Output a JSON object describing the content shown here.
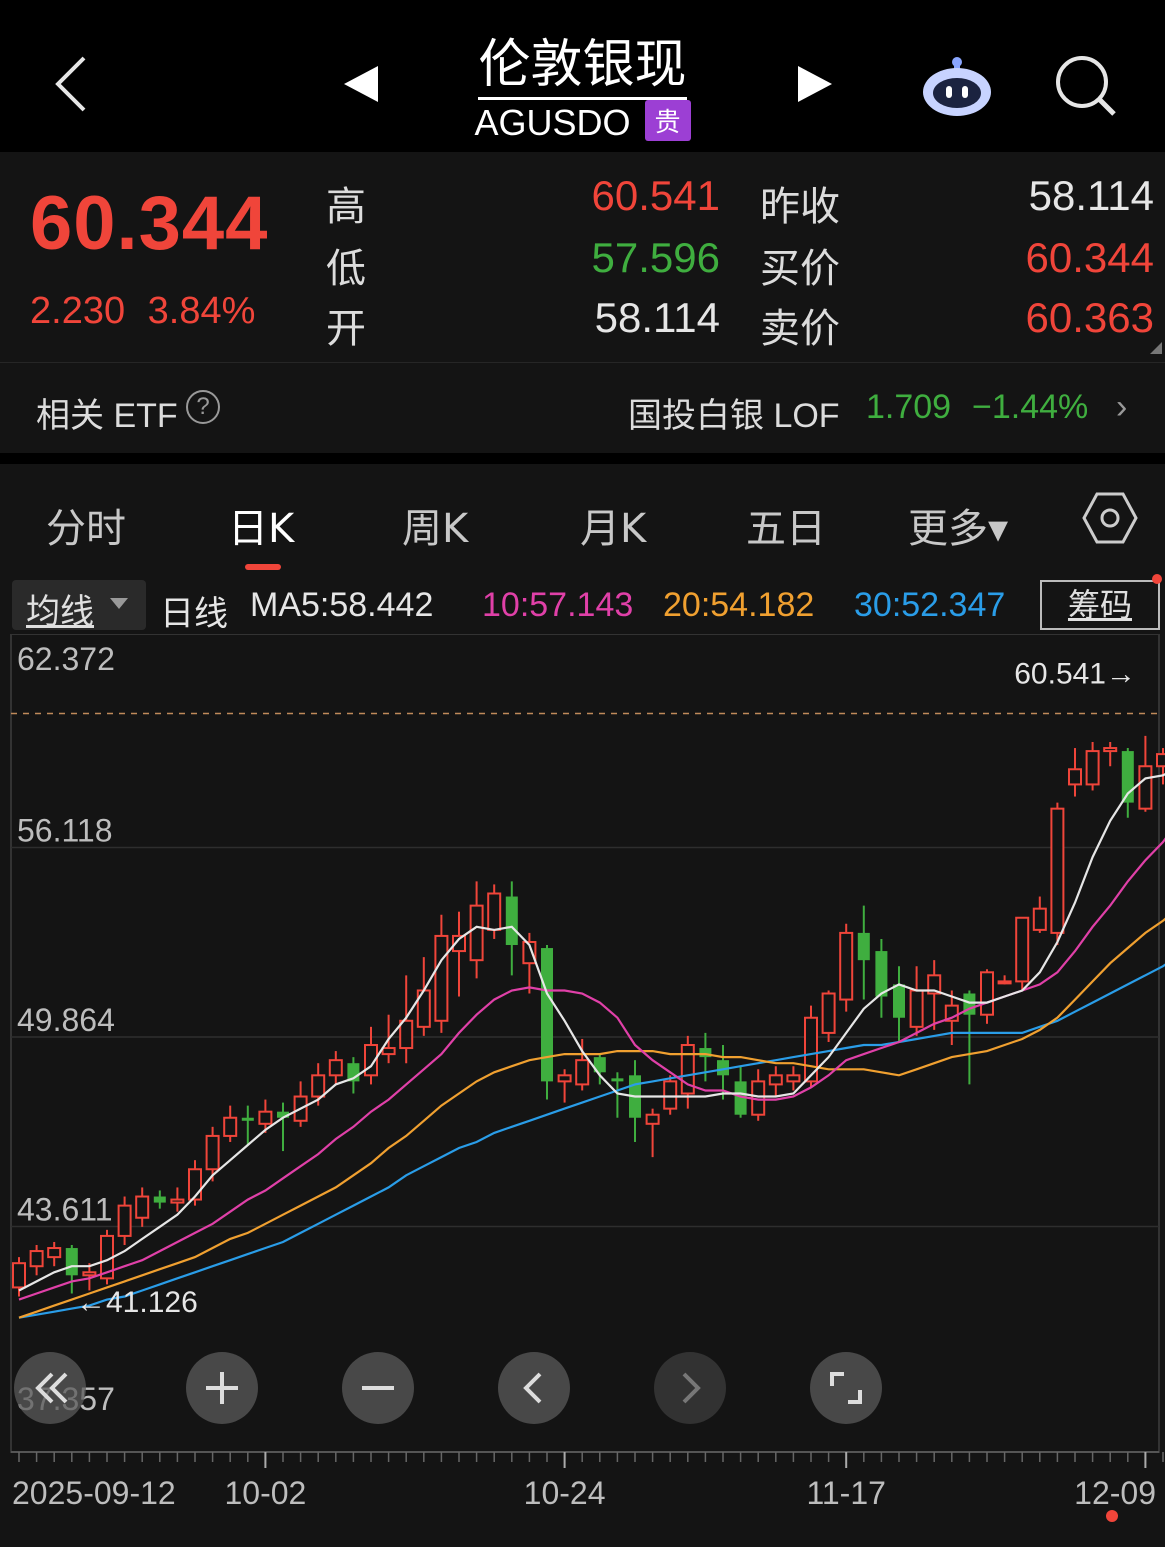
{
  "header": {
    "title": "伦敦银现",
    "code": "AGUSDO",
    "tag": "贵"
  },
  "quote": {
    "price": "60.344",
    "change": "2.230",
    "change_pct": "3.84%",
    "high_label": "高",
    "high": "60.541",
    "low_label": "低",
    "low": "57.596",
    "open_label": "开",
    "open": "58.114",
    "prev_close_label": "昨收",
    "prev_close": "58.114",
    "bid_label": "买价",
    "bid": "60.344",
    "ask_label": "卖价",
    "ask": "60.363"
  },
  "etf": {
    "label": "相关 ETF",
    "help": "?",
    "name": "国投白银 LOF",
    "price": "1.709",
    "pct": "−1.44%",
    "arrow": "›"
  },
  "tabs": [
    "分时",
    "日K",
    "周K",
    "月K",
    "五日",
    "更多▾"
  ],
  "active_tab": 1,
  "indicators": {
    "selector": "均线",
    "period": "日线",
    "ma5": "MA5:58.442",
    "ma10": "10:57.143",
    "ma20": "20:54.182",
    "ma30": "30:52.347",
    "chips": "筹码"
  },
  "colors": {
    "up": "#f0453a",
    "down": "#3fae3f",
    "ma5": "#e6e6e6",
    "ma10": "#e040a8",
    "ma20": "#f0a030",
    "ma30": "#2a9de8"
  },
  "chart_data": {
    "type": "candlestick",
    "y_ticks": [
      "62.372",
      "56.118",
      "49.864",
      "43.611",
      "37.357"
    ],
    "ylim": [
      37.357,
      62.372
    ],
    "x_labels": [
      "2025-09-12",
      "10-02",
      "10-24",
      "11-17",
      "12-09"
    ],
    "high_marker": "60.541→",
    "high_marker_value": 60.541,
    "low_marker": "←41.126",
    "low_marker_value": 41.126,
    "candles": [
      [
        41.6,
        42.4,
        41.3,
        42.6
      ],
      [
        42.3,
        42.8,
        42.0,
        43.0
      ],
      [
        42.6,
        42.9,
        42.3,
        43.1
      ],
      [
        42.9,
        42.0,
        41.4,
        43.0
      ],
      [
        42.0,
        42.1,
        41.5,
        42.4
      ],
      [
        41.9,
        43.3,
        41.7,
        43.5
      ],
      [
        43.3,
        44.3,
        43.0,
        44.6
      ],
      [
        43.9,
        44.6,
        43.6,
        44.9
      ],
      [
        44.6,
        44.4,
        44.2,
        44.8
      ],
      [
        44.4,
        44.5,
        44.1,
        44.9
      ],
      [
        44.5,
        45.5,
        44.3,
        45.8
      ],
      [
        45.5,
        46.6,
        45.1,
        46.9
      ],
      [
        46.6,
        47.2,
        46.4,
        47.6
      ],
      [
        47.2,
        47.1,
        46.3,
        47.6
      ],
      [
        47.0,
        47.4,
        46.7,
        47.8
      ],
      [
        47.4,
        47.2,
        46.1,
        47.7
      ],
      [
        47.1,
        47.9,
        46.9,
        48.4
      ],
      [
        47.9,
        48.6,
        47.6,
        49.0
      ],
      [
        48.6,
        49.1,
        48.3,
        49.4
      ],
      [
        49.0,
        48.4,
        48.0,
        49.2
      ],
      [
        48.6,
        49.6,
        48.3,
        50.2
      ],
      [
        49.3,
        49.5,
        49.0,
        50.6
      ],
      [
        49.5,
        50.4,
        49.0,
        51.9
      ],
      [
        50.2,
        51.4,
        49.9,
        52.5
      ],
      [
        50.4,
        53.2,
        50.0,
        53.9
      ],
      [
        52.7,
        53.2,
        51.2,
        54.0
      ],
      [
        52.4,
        54.2,
        51.8,
        55.0
      ],
      [
        53.4,
        54.6,
        53.1,
        54.9
      ],
      [
        54.5,
        52.9,
        51.9,
        55.0
      ],
      [
        52.3,
        53.0,
        51.3,
        53.3
      ],
      [
        52.8,
        48.4,
        47.8,
        52.9
      ],
      [
        48.4,
        48.6,
        47.7,
        48.8
      ],
      [
        48.3,
        49.1,
        48.1,
        49.8
      ],
      [
        49.2,
        48.7,
        48.3,
        49.3
      ],
      [
        48.5,
        48.4,
        47.2,
        48.7
      ],
      [
        48.6,
        47.2,
        46.4,
        49.1
      ],
      [
        47.0,
        47.3,
        45.9,
        47.5
      ],
      [
        47.5,
        48.4,
        47.3,
        48.6
      ],
      [
        48.0,
        49.6,
        47.5,
        49.9
      ],
      [
        49.5,
        49.2,
        48.4,
        50.0
      ],
      [
        49.1,
        48.6,
        47.8,
        49.6
      ],
      [
        48.4,
        47.3,
        47.2,
        48.9
      ],
      [
        47.3,
        48.4,
        47.1,
        48.8
      ],
      [
        48.3,
        48.6,
        47.9,
        48.9
      ],
      [
        48.4,
        48.6,
        48.1,
        48.9
      ],
      [
        48.4,
        50.5,
        48.2,
        50.9
      ],
      [
        50.0,
        51.3,
        49.7,
        51.4
      ],
      [
        51.1,
        53.3,
        50.7,
        53.6
      ],
      [
        53.3,
        52.4,
        51.1,
        54.2
      ],
      [
        52.7,
        51.2,
        50.5,
        53.1
      ],
      [
        51.6,
        50.5,
        49.7,
        52.2
      ],
      [
        50.2,
        51.4,
        49.9,
        52.2
      ],
      [
        51.3,
        51.9,
        50.1,
        52.4
      ],
      [
        50.4,
        50.9,
        49.6,
        51.4
      ],
      [
        51.3,
        50.6,
        48.3,
        51.4
      ],
      [
        50.6,
        52.0,
        50.3,
        52.1
      ],
      [
        51.7,
        51.7,
        51.6,
        51.9
      ],
      [
        51.7,
        53.8,
        51.4,
        53.8
      ],
      [
        53.4,
        54.1,
        53.3,
        54.5
      ],
      [
        53.3,
        57.4,
        52.9,
        57.6
      ],
      [
        58.2,
        58.7,
        57.8,
        59.4
      ],
      [
        58.2,
        59.3,
        58.0,
        59.6
      ],
      [
        59.3,
        59.4,
        58.8,
        59.6
      ],
      [
        59.3,
        57.6,
        57.1,
        59.4
      ],
      [
        57.4,
        58.8,
        57.3,
        59.8
      ],
      [
        58.8,
        59.2,
        58.2,
        59.4
      ],
      [
        58.1,
        60.3,
        57.6,
        60.5
      ]
    ],
    "ma5": [
      41.5,
      41.8,
      42.1,
      42.3,
      42.3,
      42.5,
      42.8,
      43.2,
      43.6,
      44.0,
      44.6,
      45.3,
      45.8,
      46.3,
      46.8,
      47.2,
      47.5,
      47.8,
      48.3,
      48.5,
      48.9,
      49.8,
      50.5,
      51.4,
      52.4,
      53.1,
      53.5,
      53.4,
      53.5,
      52.9,
      51.3,
      50.4,
      49.4,
      48.6,
      48.0,
      47.9,
      47.9,
      47.9,
      47.9,
      47.9,
      48.0,
      48.0,
      47.9,
      47.9,
      48.0,
      48.6,
      49.2,
      50.0,
      50.8,
      51.3,
      51.6,
      51.4,
      51.4,
      51.2,
      51.0,
      51.0,
      51.2,
      51.4,
      52.0,
      53.0,
      54.3,
      55.8,
      57.0,
      57.9,
      58.4,
      58.5,
      58.8
    ],
    "ma10": [
      41.2,
      41.4,
      41.6,
      41.8,
      41.9,
      42.1,
      42.3,
      42.5,
      42.8,
      43.1,
      43.4,
      43.7,
      44.1,
      44.5,
      44.8,
      45.2,
      45.6,
      46.0,
      46.5,
      46.9,
      47.4,
      47.8,
      48.3,
      48.8,
      49.3,
      50.0,
      50.6,
      51.1,
      51.4,
      51.5,
      51.4,
      51.4,
      51.3,
      51.0,
      50.5,
      49.6,
      49.1,
      48.7,
      48.3,
      48.1,
      48.1,
      47.9,
      47.8,
      47.8,
      47.9,
      48.2,
      48.6,
      49.1,
      49.3,
      49.5,
      49.7,
      50.0,
      50.3,
      50.5,
      50.8,
      51.0,
      51.2,
      51.4,
      51.6,
      52.0,
      52.7,
      53.5,
      54.2,
      55.0,
      55.7,
      56.3,
      57.1
    ],
    "ma20": [
      40.6,
      40.8,
      41.0,
      41.2,
      41.4,
      41.6,
      41.8,
      42.0,
      42.2,
      42.4,
      42.6,
      42.9,
      43.2,
      43.4,
      43.7,
      44.0,
      44.3,
      44.6,
      44.9,
      45.3,
      45.7,
      46.2,
      46.6,
      47.1,
      47.6,
      48.0,
      48.4,
      48.7,
      48.9,
      49.1,
      49.2,
      49.3,
      49.3,
      49.3,
      49.4,
      49.4,
      49.4,
      49.3,
      49.3,
      49.3,
      49.2,
      49.2,
      49.1,
      49.0,
      49.0,
      48.9,
      48.8,
      48.8,
      48.8,
      48.7,
      48.6,
      48.8,
      49.0,
      49.2,
      49.3,
      49.4,
      49.6,
      49.8,
      50.1,
      50.5,
      51.1,
      51.7,
      52.3,
      52.8,
      53.3,
      53.7,
      54.2
    ],
    "ma30": [
      40.6,
      40.7,
      40.8,
      40.9,
      41.0,
      41.2,
      41.3,
      41.5,
      41.7,
      41.9,
      42.1,
      42.3,
      42.5,
      42.7,
      42.9,
      43.1,
      43.4,
      43.7,
      44.0,
      44.3,
      44.6,
      44.9,
      45.3,
      45.6,
      45.9,
      46.2,
      46.4,
      46.7,
      46.9,
      47.1,
      47.3,
      47.5,
      47.7,
      47.9,
      48.1,
      48.3,
      48.4,
      48.5,
      48.6,
      48.7,
      48.8,
      48.9,
      49.0,
      49.1,
      49.2,
      49.3,
      49.4,
      49.5,
      49.6,
      49.6,
      49.7,
      49.8,
      49.9,
      50.0,
      50.0,
      50.0,
      50.0,
      50.0,
      50.2,
      50.4,
      50.7,
      51.0,
      51.3,
      51.6,
      51.9,
      52.2,
      52.6
    ]
  }
}
